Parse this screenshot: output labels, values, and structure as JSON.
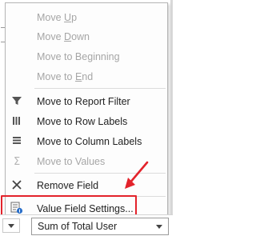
{
  "menu": {
    "items": [
      {
        "label": "Move Up",
        "mnemonic": "U",
        "enabled": false,
        "icon": null
      },
      {
        "label": "Move Down",
        "mnemonic": "D",
        "enabled": false,
        "icon": null
      },
      {
        "label": "Move to Beginning",
        "mnemonic": "G",
        "enabled": false,
        "icon": null
      },
      {
        "label": "Move to End",
        "mnemonic": "E",
        "enabled": false,
        "icon": null
      },
      {
        "label": "Move to Report Filter",
        "enabled": true,
        "icon": "filter-icon"
      },
      {
        "label": "Move to Row Labels",
        "enabled": true,
        "icon": "row-labels-icon"
      },
      {
        "label": "Move to Column Labels",
        "enabled": true,
        "icon": "column-labels-icon"
      },
      {
        "label": "Move to Values",
        "enabled": false,
        "icon": "sigma-icon"
      },
      {
        "label": "Remove Field",
        "enabled": true,
        "icon": "close-x-icon"
      },
      {
        "label": "Value Field Settings...",
        "enabled": true,
        "icon": "field-settings-icon"
      }
    ]
  },
  "values_area": {
    "field": "Sum of Total User"
  },
  "colors": {
    "highlight": "#e3232b",
    "arrow": "#e3232b",
    "disabled_text": "#a6a6a6",
    "text": "#222222"
  }
}
